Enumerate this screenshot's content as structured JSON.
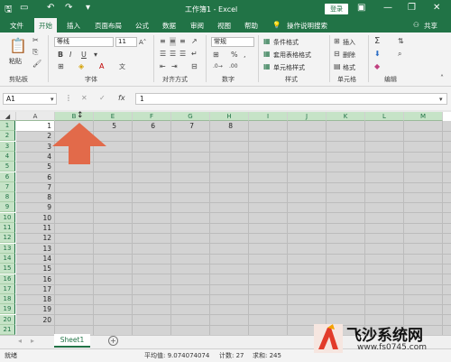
{
  "window": {
    "title": "工作簿1 - Excel",
    "login_label": "登录",
    "minimize": "—",
    "restore": "❐",
    "close": "✕"
  },
  "tabs": [
    {
      "label": "文件"
    },
    {
      "label": "开始",
      "active": true
    },
    {
      "label": "插入"
    },
    {
      "label": "页面布局"
    },
    {
      "label": "公式"
    },
    {
      "label": "数据"
    },
    {
      "label": "审阅"
    },
    {
      "label": "视图"
    },
    {
      "label": "帮助"
    },
    {
      "label": "操作说明搜索"
    }
  ],
  "share_label": "共享",
  "ribbon": {
    "clipboard": {
      "paste": "粘贴",
      "label": "剪贴板"
    },
    "font": {
      "name": "等线",
      "size": "11",
      "label": "字体"
    },
    "alignment": {
      "label": "对齐方式"
    },
    "number": {
      "format": "常规",
      "label": "数字"
    },
    "styles": {
      "conditional": "条件格式",
      "table": "套用表格格式",
      "cell": "单元格样式",
      "label": "样式"
    },
    "cells": {
      "insert": "插入",
      "delete": "删除",
      "format": "格式",
      "label": "单元格"
    },
    "editing": {
      "label": "编辑"
    }
  },
  "formula_bar": {
    "name_box": "A1",
    "fx": "fx",
    "value": "1"
  },
  "columns": [
    "A",
    "B",
    "E",
    "F",
    "G",
    "H",
    "I",
    "J",
    "K",
    "L",
    "M"
  ],
  "rows": [
    "1",
    "2",
    "3",
    "4",
    "5",
    "6",
    "7",
    "8",
    "9",
    "10",
    "11",
    "12",
    "13",
    "14",
    "15",
    "16",
    "17",
    "18",
    "19",
    "20",
    "21"
  ],
  "cells": {
    "A": [
      "1",
      "2",
      "3",
      "4",
      "5",
      "6",
      "7",
      "8",
      "9",
      "10",
      "11",
      "12",
      "13",
      "14",
      "15",
      "16",
      "17",
      "18",
      "19",
      "20"
    ],
    "row1": {
      "E": "5",
      "F": "6",
      "G": "7",
      "H": "8"
    }
  },
  "sheet": {
    "name": "Sheet1",
    "add": "+"
  },
  "status": {
    "mode": "就绪",
    "average": "平均值: 9.074074074",
    "count": "计数: 27",
    "sum": "求和: 245"
  },
  "watermark": {
    "title": "飞沙系统网",
    "url": "www.fs0745.com"
  },
  "colors": {
    "excel_green": "#217346",
    "arrow": "#e26a4a"
  }
}
